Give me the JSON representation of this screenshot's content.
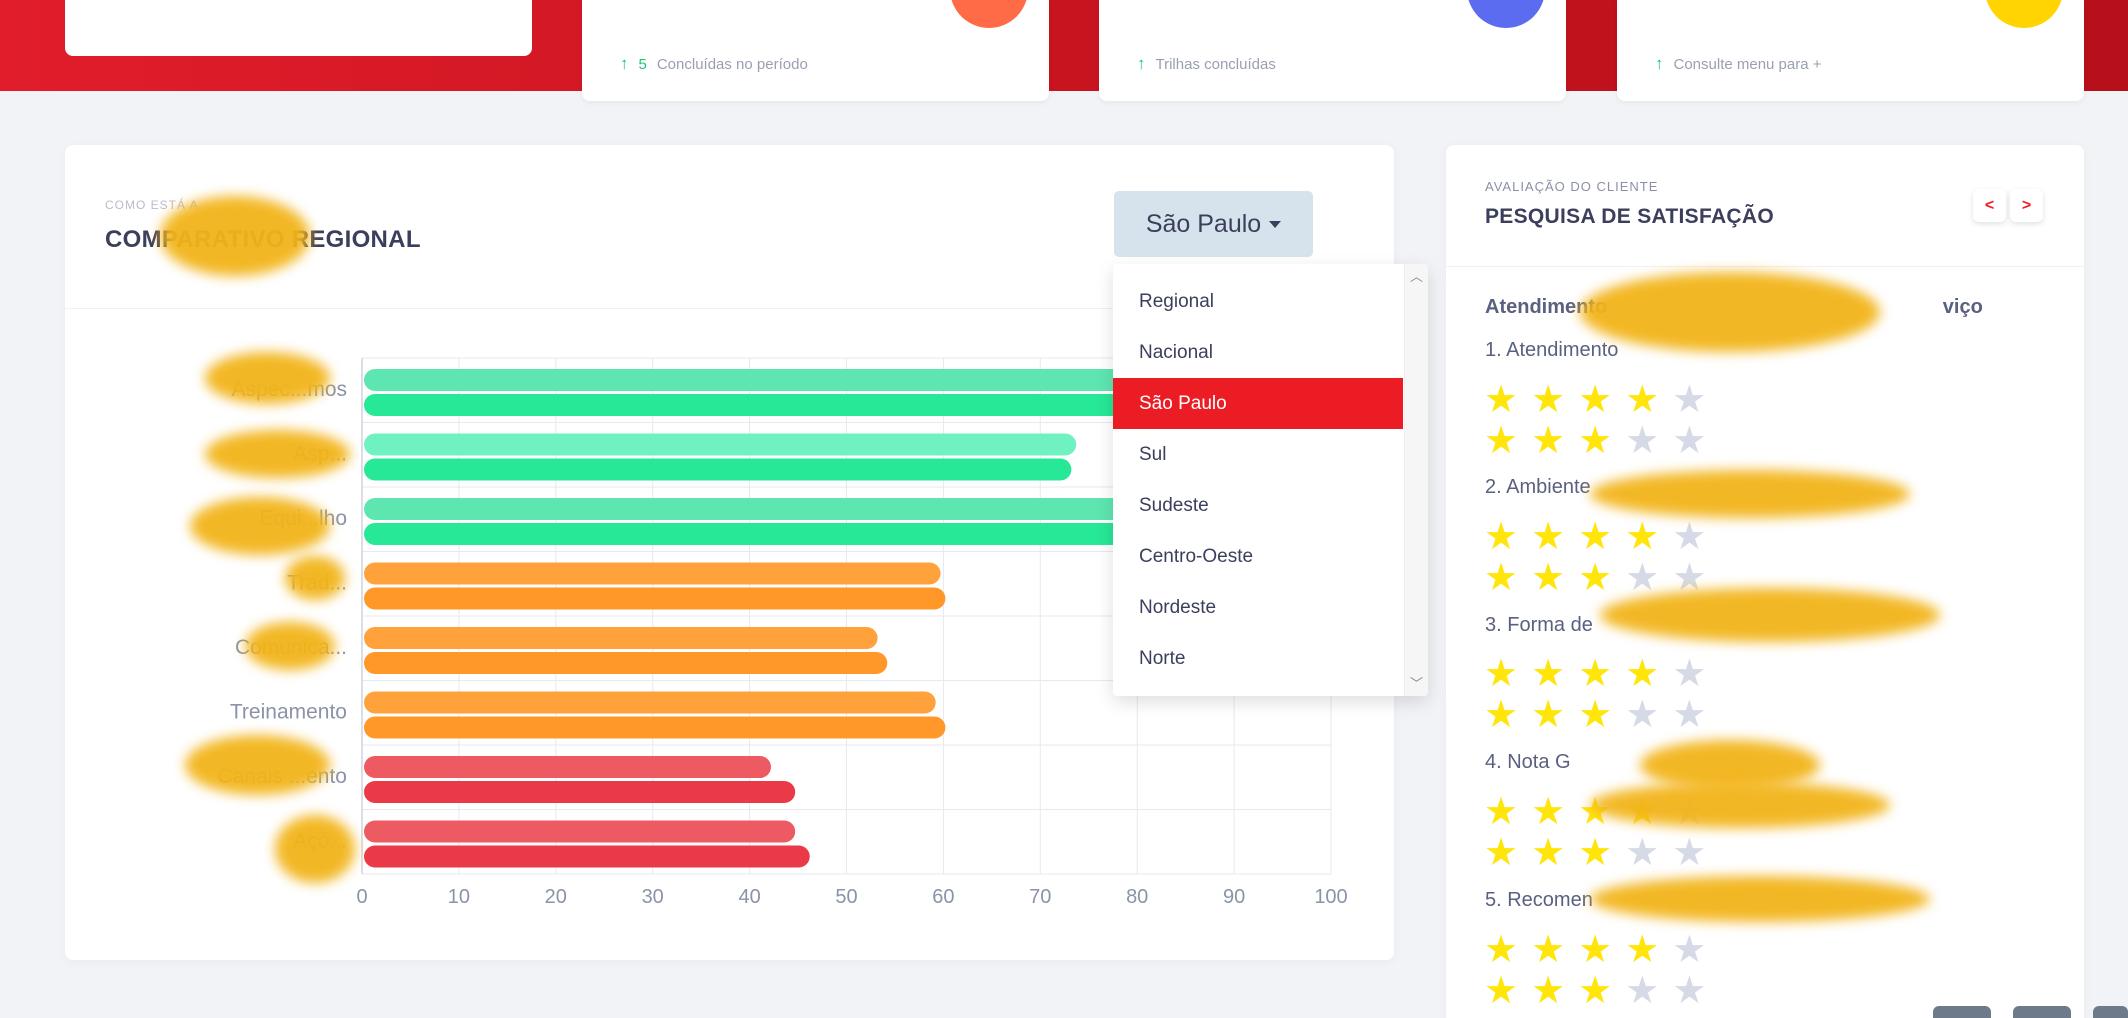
{
  "stats": [
    {
      "arrow": "↑",
      "count": "5",
      "label": "Concluídas no período",
      "circle_color": "#ff6b47"
    },
    {
      "arrow": "↑",
      "count": "",
      "label": "Trilhas concluídas",
      "circle_color": "#5c6cf0"
    },
    {
      "arrow": "↑",
      "count": "",
      "label": "Consulte menu para +",
      "circle_color": "#ffd400"
    }
  ],
  "comparativo": {
    "kicker": "COMO ESTÁ A",
    "title": "COMPARATIVO REGIONAL",
    "dropdown": {
      "selected": "São Paulo",
      "options": [
        "Regional",
        "Nacional",
        "São Paulo",
        "Sul",
        "Sudeste",
        "Centro-Oeste",
        "Nordeste",
        "Norte"
      ],
      "active_index": 2
    }
  },
  "chart_data": {
    "type": "bar",
    "orientation": "horizontal",
    "categories": [
      "Aspec...mos",
      "Asp...",
      "Equi...lho",
      "Trad...",
      "Comunica...",
      "Treinamento",
      "Canais ...ento",
      "Açõ..."
    ],
    "series": [
      {
        "values": [
          85,
          73.5,
          85,
          59.5,
          53,
          59,
          42,
          44.5
        ],
        "colors": [
          "#5ee6b0",
          "#70f1c2",
          "#5ee6b0",
          "#ffa23c",
          "#ffa23c",
          "#ffa23c",
          "#ee5a62",
          "#ee5a62"
        ]
      },
      {
        "values": [
          85,
          73,
          85,
          60,
          54,
          60,
          44.5,
          46
        ],
        "colors": [
          "#27e896",
          "#27e896",
          "#27e896",
          "#ff9829",
          "#ff9829",
          "#ff9829",
          "#ea3a47",
          "#ea3a47"
        ]
      }
    ],
    "xticks": [
      0,
      10,
      20,
      30,
      40,
      50,
      60,
      70,
      80,
      90,
      100
    ],
    "xlim": [
      0,
      100
    ],
    "grid": true
  },
  "satisfacao": {
    "kicker": "AVALIAÇÃO DO CLIENTE",
    "title": "PESQUISA DE SATISFAÇÃO",
    "prev_label": "<",
    "next_label": ">",
    "heading": "Atendimento",
    "heading_tail": "viço",
    "questions": [
      {
        "label": "1. Atendimento",
        "rating_a": 4,
        "rating_b": 3
      },
      {
        "label": "2. Ambiente",
        "rating_a": 4,
        "rating_b": 3
      },
      {
        "label": "3. Forma de",
        "rating_a": 4,
        "rating_b": 3
      },
      {
        "label": "4. Nota G",
        "rating_a": 4,
        "rating_b": 3
      },
      {
        "label": "5. Recomen",
        "rating_a": 4,
        "rating_b": 3
      }
    ],
    "max_stars": 5
  }
}
